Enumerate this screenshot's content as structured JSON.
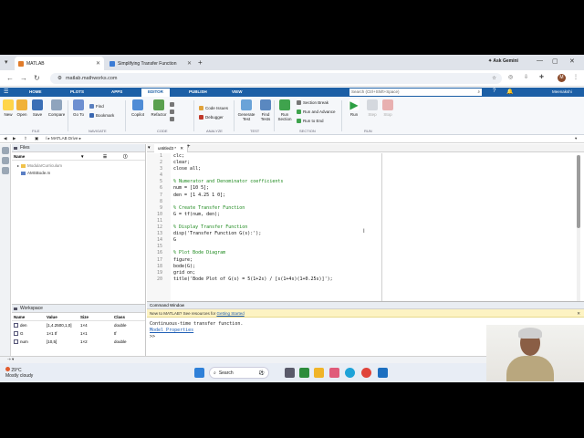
{
  "browser": {
    "tabs": [
      {
        "label": "MATLAB",
        "active": true
      },
      {
        "label": "Simplifying Transfer Function",
        "active": false
      }
    ],
    "new_tab": "+",
    "ask_gemini": "Ask Gemini",
    "url": "matlab.mathworks.com",
    "profile_initial": "M"
  },
  "matlab": {
    "tabs": [
      "HOME",
      "PLOTS",
      "APPS",
      "EDITOR",
      "PUBLISH",
      "VIEW"
    ],
    "active_tab": "EDITOR",
    "search_placeholder": "Search (Ctrl+Shift+Space)",
    "user": "Meenakshi",
    "toolstrip": {
      "file": {
        "new": "New",
        "open": "Open",
        "save": "Save",
        "compare": "Compare",
        "group": "FILE"
      },
      "navigate": {
        "goto": "Go To",
        "find": "Find",
        "bookmark": "Bookmark",
        "group": "NAVIGATE"
      },
      "code": {
        "copilot": "Copilot",
        "refactor": "Refactor",
        "group": "CODE"
      },
      "analyze": {
        "code_issues": "Code Issues",
        "debugger": "Debugger",
        "group": "ANALYZE"
      },
      "test": {
        "generate": "Generate Test",
        "find": "Find Tests",
        "group": "TEST"
      },
      "section": {
        "run_section": "Run Section",
        "section_break": "Section Break",
        "run_and_advance": "Run and Advance",
        "run_to_end": "Run to End",
        "group": "SECTION"
      },
      "run": {
        "run": "Run",
        "step": "Step",
        "stop": "Stop",
        "group": "RUN"
      }
    },
    "path": "MATLAB Drive",
    "files_panel": {
      "title": "Files",
      "col_name": "Name",
      "items": [
        {
          "name": "ModularCurriculum",
          "type": "folder"
        },
        {
          "name": "AMSBode.m",
          "type": "file"
        }
      ]
    },
    "workspace": {
      "title": "Workspace",
      "columns": [
        "Name",
        "Value",
        "Size",
        "Class"
      ],
      "rows": [
        {
          "name": "den",
          "value": "[1,4.2500,1,0]",
          "size": "1×4",
          "class": "double"
        },
        {
          "name": "G",
          "value": "1×1 tf",
          "size": "1×1",
          "class": "tf"
        },
        {
          "name": "num",
          "value": "[10,5]",
          "size": "1×2",
          "class": "double"
        }
      ]
    },
    "editor": {
      "tab_label": "untitled3 *",
      "lines": [
        {
          "n": "1",
          "text": "clc;",
          "kind": "code"
        },
        {
          "n": "2",
          "text": "clear;",
          "kind": "code"
        },
        {
          "n": "3",
          "text": "close all;",
          "kind": "code"
        },
        {
          "n": "4",
          "text": "",
          "kind": "code"
        },
        {
          "n": "5",
          "text": "% Numerator and Denominator coefficients",
          "kind": "comment"
        },
        {
          "n": "6",
          "text": "num = [10 5];",
          "kind": "code"
        },
        {
          "n": "7",
          "text": "den = [1 4.25 1 0];",
          "kind": "code"
        },
        {
          "n": "8",
          "text": "",
          "kind": "code"
        },
        {
          "n": "9",
          "text": "% Create Transfer Function",
          "kind": "comment"
        },
        {
          "n": "10",
          "text": "G = tf(num, den);",
          "kind": "code"
        },
        {
          "n": "11",
          "text": "",
          "kind": "code"
        },
        {
          "n": "12",
          "text": "% Display Transfer Function",
          "kind": "comment"
        },
        {
          "n": "13",
          "text": "disp('Transfer Function G(s):');",
          "kind": "code"
        },
        {
          "n": "14",
          "text": "G",
          "kind": "code"
        },
        {
          "n": "15",
          "text": "",
          "kind": "code"
        },
        {
          "n": "16",
          "text": "% Plot Bode Diagram",
          "kind": "comment"
        },
        {
          "n": "17",
          "text": "figure;",
          "kind": "code"
        },
        {
          "n": "18",
          "text": "bode(G);",
          "kind": "code"
        },
        {
          "n": "19",
          "text": "grid on;",
          "kind": "code"
        },
        {
          "n": "20",
          "text": "title('Bode Plot of G(s) = 5(1+2s) / [s(1+4s)(1+0.25s)]');",
          "kind": "code"
        }
      ]
    },
    "command_window": {
      "title": "Command Window",
      "notice_prefix": "New to MATLAB? See resources for ",
      "notice_link": "Getting Started",
      "lines": [
        "Continuous-time transfer function.",
        "Model Properties",
        ">>"
      ]
    }
  },
  "taskbar": {
    "temperature": "29°C",
    "weather": "Mostly cloudy",
    "search_label": "Search"
  }
}
